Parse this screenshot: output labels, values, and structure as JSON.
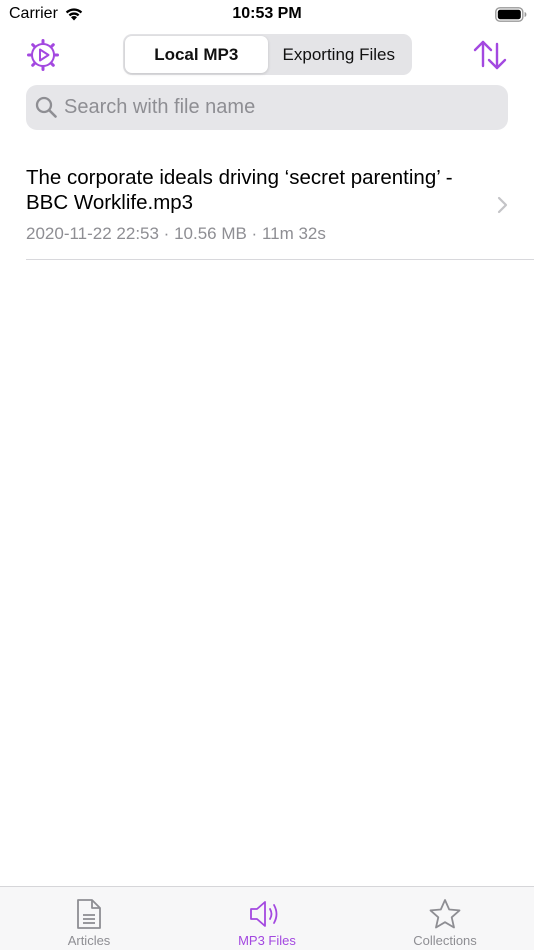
{
  "status_bar": {
    "carrier": "Carrier",
    "time": "10:53 PM"
  },
  "nav": {
    "segments": [
      {
        "label": "Local MP3",
        "active": true
      },
      {
        "label": "Exporting Files",
        "active": false
      }
    ],
    "left_icon": "gear-play-icon",
    "right_icon": "sort-arrows-icon"
  },
  "search": {
    "placeholder": "Search with file name",
    "value": ""
  },
  "files": [
    {
      "title": "The corporate ideals driving ‘secret parenting’ - BBC Worklife.mp3",
      "meta": "2020-11-22 22:53 · 10.56 MB · 11m 32s"
    }
  ],
  "tabs": [
    {
      "label": "Articles",
      "icon": "document-icon",
      "active": false
    },
    {
      "label": "MP3 Files",
      "icon": "speaker-icon",
      "active": true
    },
    {
      "label": "Collections",
      "icon": "star-icon",
      "active": false
    }
  ],
  "colors": {
    "accent": "#a348e0",
    "inactive": "#8e8e93",
    "search_bg": "#e6e6e9"
  }
}
